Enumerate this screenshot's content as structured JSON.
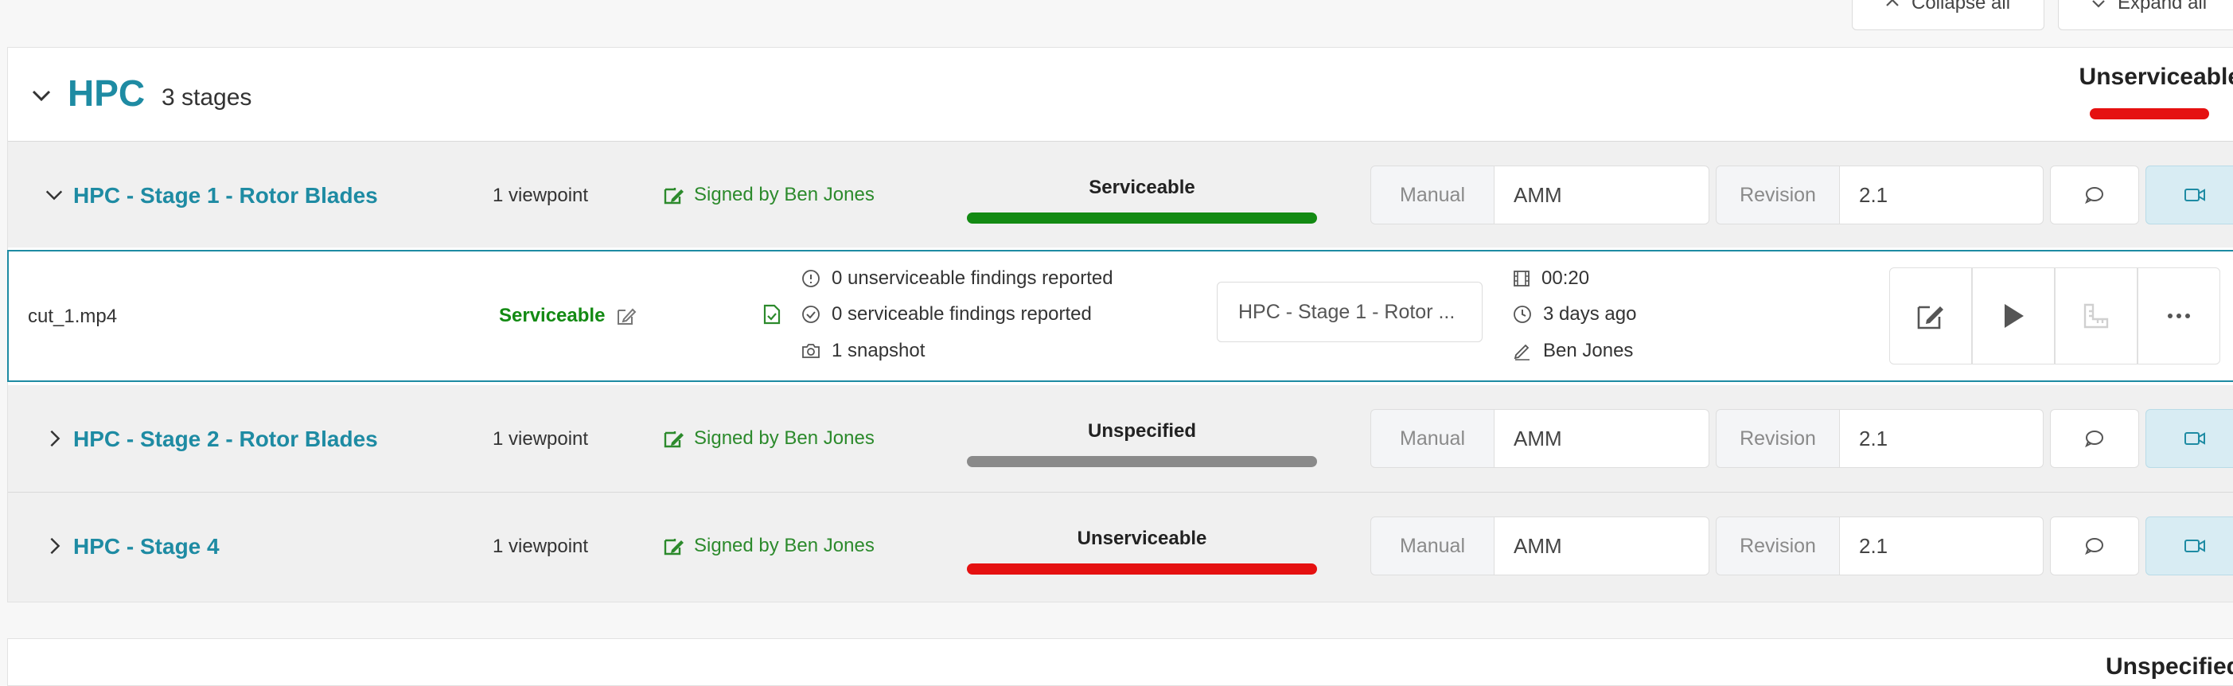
{
  "toolbar": {
    "collapse_all": "Collapse all",
    "expand_all": "Expand all"
  },
  "section": {
    "title": "HPC",
    "stage_count": "3 stages",
    "status": "Unserviceable",
    "status_color": "#e51111"
  },
  "stages": [
    {
      "title": "HPC - Stage 1 - Rotor Blades",
      "viewpoints": "1 viewpoint",
      "signed": "Signed by Ben Jones",
      "status": "Serviceable",
      "status_color": "#138a13",
      "manual_label": "Manual",
      "manual_value": "AMM",
      "revision_label": "Revision",
      "revision_value": "2.1",
      "expanded": true
    },
    {
      "title": "HPC - Stage 2 - Rotor Blades",
      "viewpoints": "1 viewpoint",
      "signed": "Signed by Ben Jones",
      "status": "Unspecified",
      "status_color": "#8a8a8a",
      "manual_label": "Manual",
      "manual_value": "AMM",
      "revision_label": "Revision",
      "revision_value": "2.1",
      "expanded": false
    },
    {
      "title": "HPC - Stage 4",
      "viewpoints": "1 viewpoint",
      "signed": "Signed by Ben Jones",
      "status": "Unserviceable",
      "status_color": "#e51111",
      "manual_label": "Manual",
      "manual_value": "AMM",
      "revision_label": "Revision",
      "revision_value": "2.1",
      "expanded": false
    }
  ],
  "video": {
    "filename": "cut_1.mp4",
    "status": "Serviceable",
    "unserviceable_findings": "0 unserviceable findings reported",
    "serviceable_findings": "0 serviceable findings reported",
    "snapshots": "1 snapshot",
    "viewpoint_select": "HPC - Stage 1 - Rotor ...",
    "duration": "00:20",
    "age": "3 days ago",
    "author": "Ben Jones"
  },
  "next_section": {
    "status": "Unspecified"
  },
  "icons": [
    "chevron-up-icon",
    "chevron-down-icon",
    "chevron-right-icon",
    "signature-icon",
    "comment-icon",
    "video-camera-icon",
    "edit-icon",
    "file-check-icon",
    "info-circle-icon",
    "check-circle-icon",
    "camera-icon",
    "film-icon",
    "clock-icon",
    "pen-icon",
    "play-icon",
    "ruler-icon",
    "more-icon"
  ]
}
